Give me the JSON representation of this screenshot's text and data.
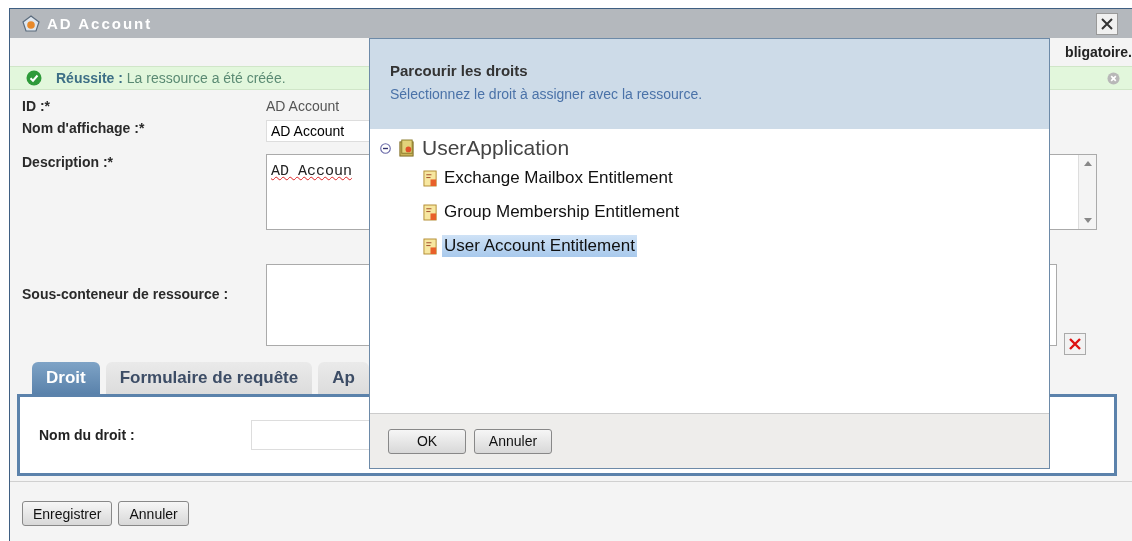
{
  "window": {
    "title": "AD Account"
  },
  "required_note": "bligatoire.",
  "message": {
    "text": "**Réussite :** La ressource a été créée."
  },
  "fields": [
    {
      "kind": "static",
      "label": "ID :*",
      "value": "AD Account"
    },
    {
      "kind": "input",
      "label": "Nom d'affichage :*",
      "value": "AD Account"
    },
    {
      "kind": "textarea",
      "label": "Description :*",
      "value": "AD Accoun"
    },
    {
      "kind": "container",
      "label": "Sous-conteneur de ressource :"
    }
  ],
  "tabs": [
    {
      "label": "Droit",
      "selected": true
    },
    {
      "label": "Formulaire de requête",
      "selected": false
    },
    {
      "label": "Ap",
      "selected": false
    }
  ],
  "tab_panel": {
    "label": "Nom du droit :"
  },
  "buttons": [
    "Enregistrer",
    "Annuler"
  ],
  "dialog": {
    "title": "Parcourir les droits",
    "subtitle": "Sélectionnez le droit à assigner avec la ressource.",
    "tree": {
      "label": "UserApplication",
      "expanded": true,
      "children": [
        {
          "label": "Exchange Mailbox Entitlement",
          "selected": false
        },
        {
          "label": "Group Membership Entitlement",
          "selected": false
        },
        {
          "label": "User Account Entitlement",
          "selected": true
        }
      ]
    },
    "buttons": [
      "OK",
      "Annuler"
    ]
  }
}
